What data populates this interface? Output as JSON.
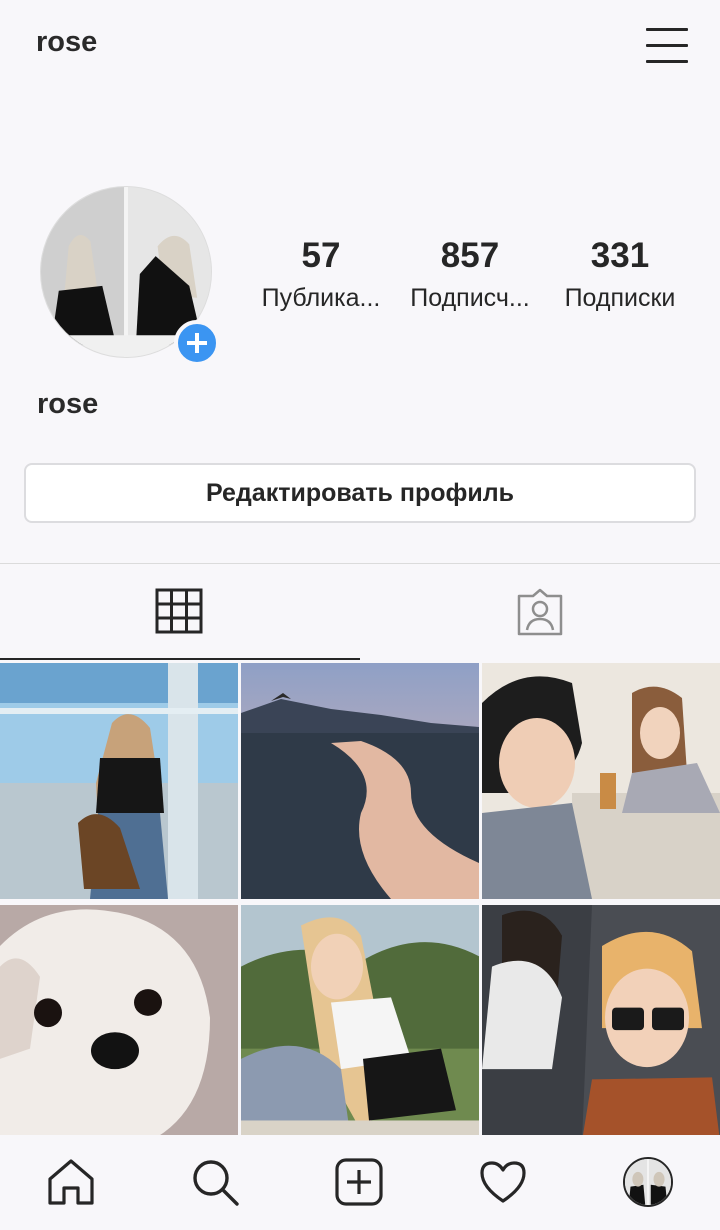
{
  "header": {
    "username": "rose"
  },
  "profile": {
    "display_name": "rose",
    "stats": [
      {
        "value": "57",
        "label": "Публика..."
      },
      {
        "value": "857",
        "label": "Подписч..."
      },
      {
        "value": "331",
        "label": "Подписки"
      }
    ],
    "edit_button_label": "Редактировать профиль"
  },
  "colors": {
    "accent": "#3b95f2",
    "text": "#262626",
    "divider": "#dbdbdb"
  },
  "tabs": [
    {
      "icon": "grid-icon",
      "active": true
    },
    {
      "icon": "tagged-person-icon",
      "active": false
    }
  ],
  "bottom_nav": [
    {
      "icon": "home-icon"
    },
    {
      "icon": "search-icon"
    },
    {
      "icon": "add-post-icon"
    },
    {
      "icon": "heart-icon"
    },
    {
      "icon": "profile-avatar-icon"
    }
  ]
}
